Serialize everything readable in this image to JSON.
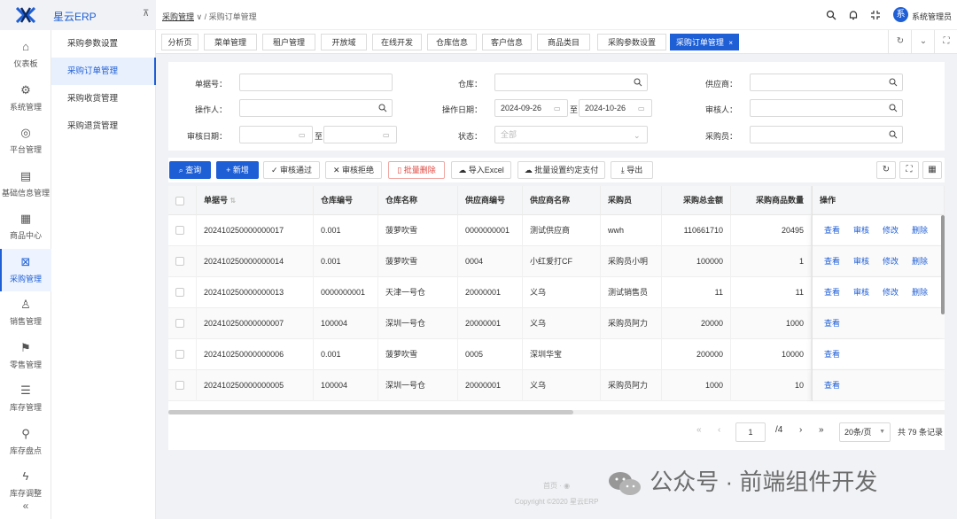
{
  "app": {
    "name": "星云ERP",
    "user_avatar": "系",
    "user_name": "系统管理员"
  },
  "colors": {
    "primary": "#1f5fd6",
    "danger": "#e0463e"
  },
  "leftnav": [
    {
      "label": "仪表板",
      "icon": "home-icon"
    },
    {
      "label": "系统管理",
      "icon": "gear-icon"
    },
    {
      "label": "平台管理",
      "icon": "globe-icon"
    },
    {
      "label": "基础信息管理",
      "icon": "doc-icon"
    },
    {
      "label": "商品中心",
      "icon": "grid-icon"
    },
    {
      "label": "采购管理",
      "icon": "purchase-icon"
    },
    {
      "label": "销售管理",
      "icon": "rocket-icon"
    },
    {
      "label": "零售管理",
      "icon": "flag-icon"
    },
    {
      "label": "库存管理",
      "icon": "list-icon"
    },
    {
      "label": "库存盘点",
      "icon": "search-icon"
    },
    {
      "label": "库存调整",
      "icon": "bolt-icon"
    }
  ],
  "submenu": [
    "采购参数设置",
    "采购订单管理",
    "采购收货管理",
    "采购退货管理"
  ],
  "breadcrumb": {
    "root": "采购管理",
    "sep": "∨ /",
    "current": "采购订单管理"
  },
  "tabs": [
    "分析页",
    "菜单管理",
    "租户管理",
    "开放域",
    "在线开发",
    "仓库信息",
    "客户信息",
    "商品类目",
    "采购参数设置",
    "采购订单管理"
  ],
  "filters": {
    "order_no": {
      "label": "单据号：",
      "value": ""
    },
    "warehouse": {
      "label": "仓库：",
      "value": ""
    },
    "supplier": {
      "label": "供应商：",
      "value": ""
    },
    "operator": {
      "label": "操作人：",
      "value": ""
    },
    "op_date": {
      "label": "操作日期：",
      "from": "2024-09-26",
      "to_sep": "至",
      "to": "2024-10-26"
    },
    "auditor": {
      "label": "审核人：",
      "value": ""
    },
    "audit_date": {
      "label": "审核日期：",
      "to_sep": "至"
    },
    "status": {
      "label": "状态：",
      "placeholder": "全部"
    },
    "buyer": {
      "label": "采购员：",
      "value": ""
    }
  },
  "toolbar": {
    "query": "查询",
    "add": "新增",
    "approve": "审核通过",
    "reject": "审核拒绝",
    "batch_delete": "批量删除",
    "import": "导入Excel",
    "batch_pay": "批量设置约定支付",
    "export": "导出"
  },
  "table": {
    "headers": [
      "单据号",
      "仓库编号",
      "仓库名称",
      "供应商编号",
      "供应商名称",
      "采购员",
      "采购总金额",
      "采购商品数量",
      "操作"
    ],
    "ops": {
      "view": "查看",
      "audit": "审核",
      "edit": "修改",
      "delete": "删除"
    },
    "rows": [
      {
        "no": "202410250000000017",
        "wh_code": "0.001",
        "wh_name": "菠萝吹雪",
        "sup_code": "0000000001",
        "sup_name": "测试供应商",
        "buyer": "wwh",
        "amount": "110661710",
        "qty": "20495",
        "full_ops": true
      },
      {
        "no": "202410250000000014",
        "wh_code": "0.001",
        "wh_name": "菠萝吹雪",
        "sup_code": "0004",
        "sup_name": "小红爱打CF",
        "buyer": "采购员小明",
        "amount": "100000",
        "qty": "1",
        "full_ops": true
      },
      {
        "no": "202410250000000013",
        "wh_code": "0000000001",
        "wh_name": "天津一号仓",
        "sup_code": "20000001",
        "sup_name": "义乌",
        "buyer": "测试销售员",
        "amount": "11",
        "qty": "11",
        "full_ops": true
      },
      {
        "no": "202410250000000007",
        "wh_code": "100004",
        "wh_name": "深圳一号仓",
        "sup_code": "20000001",
        "sup_name": "义乌",
        "buyer": "采购员阿力",
        "amount": "20000",
        "qty": "1000",
        "full_ops": false
      },
      {
        "no": "202410250000000006",
        "wh_code": "0.001",
        "wh_name": "菠萝吹雪",
        "sup_code": "0005",
        "sup_name": "深圳华宝",
        "buyer": "",
        "amount": "200000",
        "qty": "10000",
        "full_ops": false
      },
      {
        "no": "202410250000000005",
        "wh_code": "100004",
        "wh_name": "深圳一号仓",
        "sup_code": "20000001",
        "sup_name": "义乌",
        "buyer": "采购员阿力",
        "amount": "1000",
        "qty": "10",
        "full_ops": false
      }
    ]
  },
  "pagination": {
    "page": "1",
    "total_pages": "/4",
    "page_size": "20条/页",
    "total": "共 79 条记录"
  },
  "footer": {
    "links": "首页 · ",
    "copyright": "Copyright ©2020 星云ERP"
  },
  "watermark": "公众号 · 前端组件开发"
}
